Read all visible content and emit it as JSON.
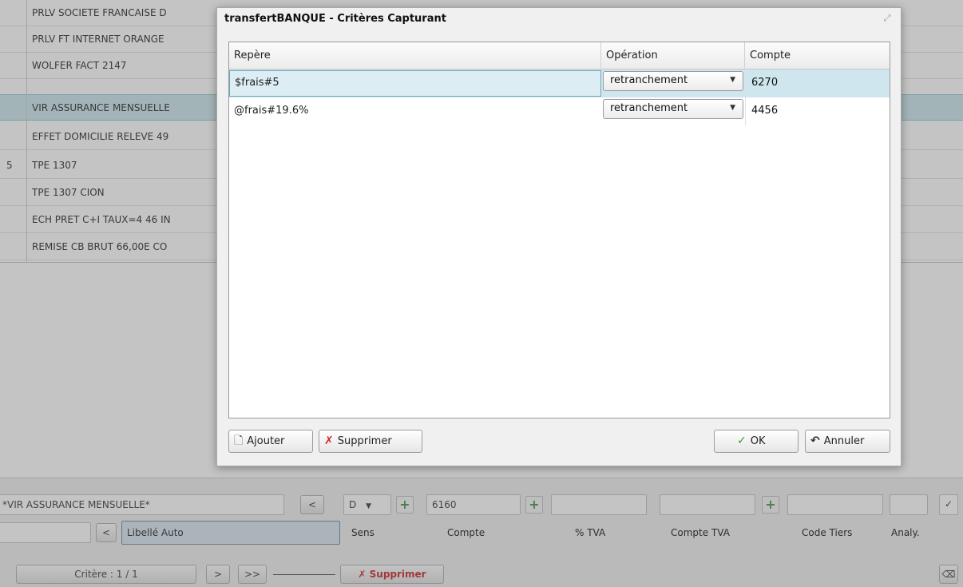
{
  "background": {
    "list_rows": [
      {
        "num": "",
        "label": "PRLV SOCIETE FRANCAISE D"
      },
      {
        "num": "",
        "label": "PRLV FT INTERNET ORANGE"
      },
      {
        "num": "",
        "label": "WOLFER FACT  2147"
      },
      {
        "num": "",
        "label": "VIR ASSURANCE MENSUELLE"
      },
      {
        "num": "",
        "label": "EFFET DOMICILIE RELEVE 49"
      },
      {
        "num": "5",
        "label": "TPE 1307"
      },
      {
        "num": "",
        "label": "TPE 1307 CION"
      },
      {
        "num": "",
        "label": "ECH PRET C+I TAUX=4 46 IN"
      },
      {
        "num": "",
        "label": "REMISE CB BRUT 66,00E CO"
      }
    ],
    "bottom": {
      "pattern_value": "*VIR ASSURANCE MENSUELLE*",
      "prev_label": "<",
      "sens_value": "D",
      "compte_value": "6160",
      "libelle_prev_label": "<",
      "libelle_auto_label": "Libellé Auto",
      "headers": {
        "sens": "Sens",
        "compte": "Compte",
        "tva": "% TVA",
        "compte_tva": "Compte TVA",
        "code_tiers": "Code Tiers",
        "analy": "Analy."
      },
      "critere_label": "Critère : 1 / 1",
      "next_label": ">",
      "last_label": ">>",
      "supprimer_label": "Supprimer"
    }
  },
  "dialog": {
    "title": "transfertBANQUE - Critères Capturant",
    "columns": {
      "repere": "Repère",
      "operation": "Opération",
      "compte": "Compte"
    },
    "rows": [
      {
        "repere": "$frais#5",
        "operation": "retranchement",
        "compte": "6270"
      },
      {
        "repere": "@frais#19.6%",
        "operation": "retranchement",
        "compte": "4456"
      }
    ],
    "buttons": {
      "ajouter": "Ajouter",
      "supprimer": "Supprimer",
      "ok": "OK",
      "annuler": "Annuler"
    },
    "colors": {
      "selection": "#cfe6ee",
      "accent_green": "#2e9a2e",
      "delete_red": "#dd2222"
    }
  }
}
